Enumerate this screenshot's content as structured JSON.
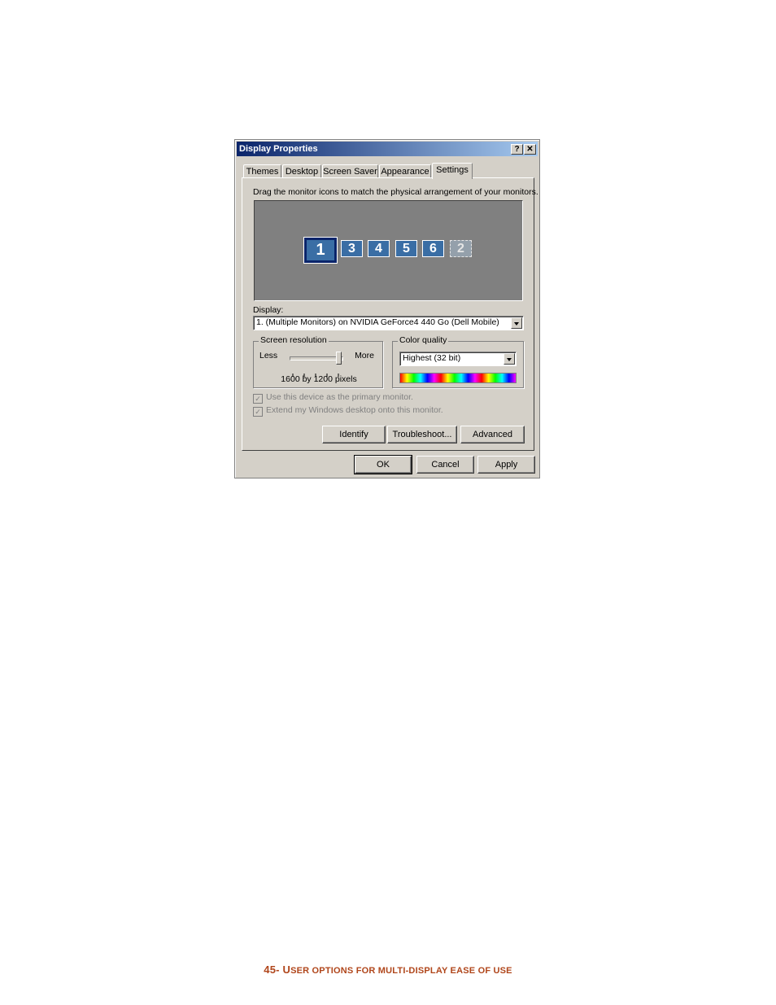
{
  "dialog": {
    "title": "Display Properties",
    "help_btn": "?",
    "close_btn": "✕"
  },
  "tabs": [
    "Themes",
    "Desktop",
    "Screen Saver",
    "Appearance",
    "Settings"
  ],
  "settings": {
    "instruction": "Drag the monitor icons to match the physical arrangement of your monitors.",
    "monitors": [
      "1",
      "3",
      "4",
      "5",
      "6",
      "2"
    ],
    "display_label": "Display:",
    "display_value": "1. (Multiple Monitors) on NVIDIA GeForce4 440 Go (Dell Mobile)",
    "resolution": {
      "legend": "Screen resolution",
      "less": "Less",
      "more": "More",
      "value_text": "1600 by 1200 pixels"
    },
    "color": {
      "legend": "Color quality",
      "value": "Highest (32 bit)"
    },
    "primary_check": "Use this device as the primary monitor.",
    "extend_check": "Extend my Windows desktop onto this monitor.",
    "buttons": {
      "identify": "Identify",
      "troubleshoot": "Troubleshoot...",
      "advanced": "Advanced"
    }
  },
  "footer_buttons": {
    "ok": "OK",
    "cancel": "Cancel",
    "apply": "Apply"
  },
  "caption": {
    "prefix": "45- U",
    "rest": "SER OPTIONS FOR MULTI-DISPLAY EASE OF USE"
  },
  "colors": {
    "title_start": "#0a246a",
    "title_end": "#a6caf0",
    "monitor_area": "#808080",
    "monitor": "#3a6ea5",
    "caption": "#b0461b"
  }
}
